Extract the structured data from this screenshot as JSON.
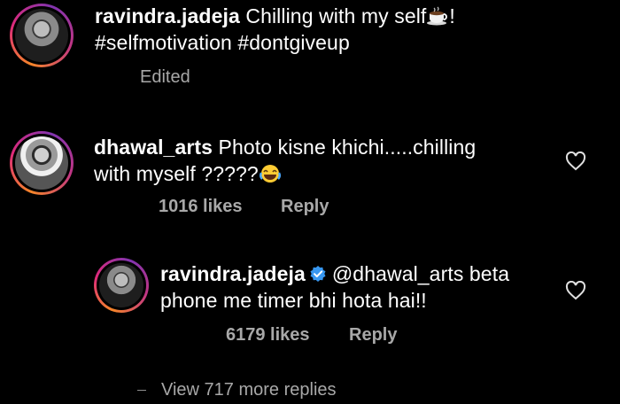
{
  "post_caption": {
    "username": "ravindra.jadeja",
    "text": "Chilling with my self",
    "text_suffix": "!",
    "emoji": "coffee-cup",
    "hashtags": "#selfmotivation #dontgiveup",
    "status": "Edited"
  },
  "comment": {
    "username": "dhawal_arts",
    "text_line1": "Photo kisne khichi.....chilling",
    "text_line2": "with myself ?????",
    "emoji": "laughing-face",
    "likes": "1016 likes",
    "reply_label": "Reply"
  },
  "reply": {
    "username": "ravindra.jadeja",
    "verified": true,
    "text_line1": "@dhawal_arts beta",
    "text_line2": "phone me timer bhi hota hai!!",
    "likes": "6179 likes",
    "reply_label": "Reply"
  },
  "view_more": "View 717 more replies",
  "colors": {
    "background": "#000000",
    "text": "#ffffff",
    "muted": "#a8a8a8",
    "verified": "#3797f0"
  }
}
